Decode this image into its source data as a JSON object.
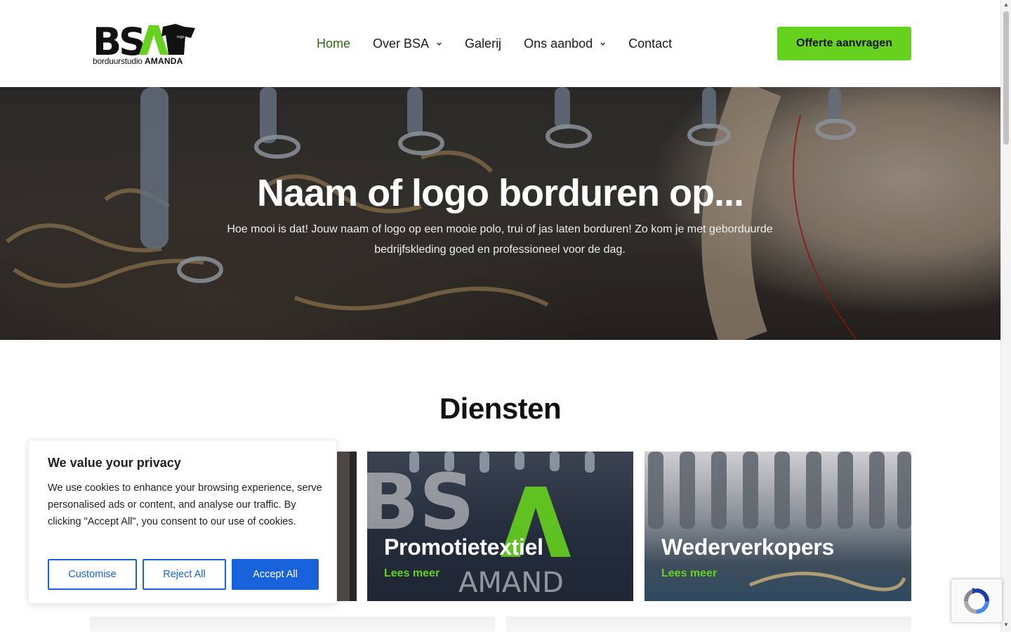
{
  "brand": {
    "logo_letters": "BSA",
    "logo_sub_regular": "borduurstudio",
    "logo_sub_bold": "AMANDA",
    "accent_green": "#66d11e",
    "dark_green": "#2e6a0a"
  },
  "nav": {
    "items": [
      {
        "label": "Home",
        "active": true,
        "has_dropdown": false
      },
      {
        "label": "Over BSA",
        "active": false,
        "has_dropdown": true
      },
      {
        "label": "Galerij",
        "active": false,
        "has_dropdown": false
      },
      {
        "label": "Ons aanbod",
        "active": false,
        "has_dropdown": true
      },
      {
        "label": "Contact",
        "active": false,
        "has_dropdown": false
      }
    ],
    "cta_label": "Offerte aanvragen"
  },
  "hero": {
    "title": "Naam of logo borduren op...",
    "subtitle": "Hoe mooi is dat! Jouw naam of logo op een mooie polo, trui of jas laten borduren! Zo kom je met geborduurde bedrijfskleding goed en professioneel voor de dag."
  },
  "diensten": {
    "heading": "Diensten",
    "cards": [
      {
        "title": "",
        "link": ""
      },
      {
        "title": "Promotietextiel",
        "link": "Lees meer"
      },
      {
        "title": "Wederverkopers",
        "link": "Lees meer"
      }
    ]
  },
  "cookie_banner": {
    "title": "We value your privacy",
    "text": "We use cookies to enhance your browsing experience, serve personalised ads or content, and analyse our traffic. By clicking \"Accept All\", you consent to our use of cookies.",
    "customise_label": "Customise",
    "reject_label": "Reject All",
    "accept_label": "Accept All",
    "button_color": "#1863dc"
  }
}
